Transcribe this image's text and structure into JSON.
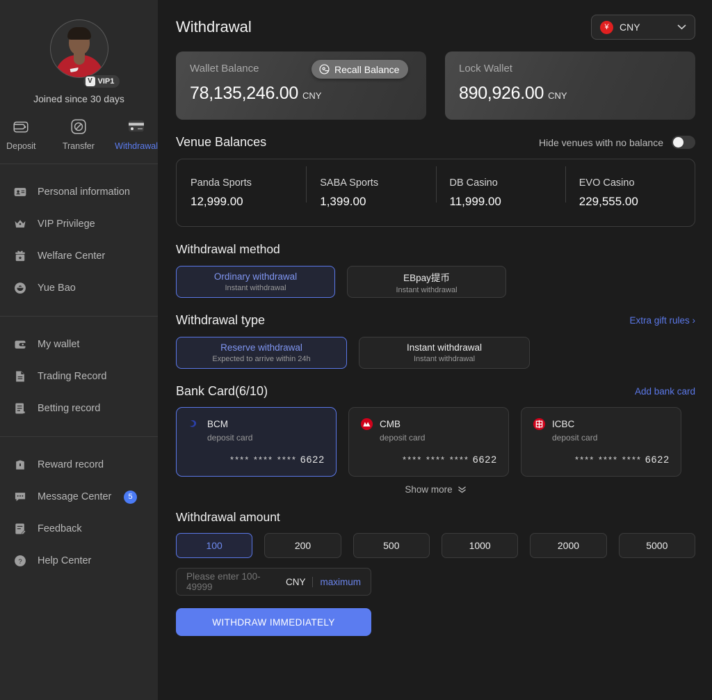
{
  "sidebar": {
    "profile": {
      "avatar_alt": "user-avatar",
      "vip_badge_mark": "V",
      "vip_label": "VIP1",
      "joined": "Joined since 30 days"
    },
    "quick_actions": [
      {
        "icon": "wallet-deposit-icon",
        "label": "Deposit",
        "active": false
      },
      {
        "icon": "transfer-icon",
        "label": "Transfer",
        "active": false
      },
      {
        "icon": "credit-card-withdrawal-icon",
        "label": "Withdrawal",
        "active": true
      }
    ],
    "groups": [
      {
        "items": [
          {
            "icon": "id-card-icon",
            "label": "Personal information"
          },
          {
            "icon": "crown-icon",
            "label": "VIP Privilege"
          },
          {
            "icon": "gift-icon",
            "label": "Welfare Center"
          },
          {
            "icon": "yuebao-icon",
            "label": "Yue Bao"
          }
        ]
      },
      {
        "items": [
          {
            "icon": "wallet-icon",
            "label": "My wallet"
          },
          {
            "icon": "document-icon",
            "label": "Trading Record"
          },
          {
            "icon": "bet-record-icon",
            "label": "Betting record"
          }
        ]
      },
      {
        "items": [
          {
            "icon": "reward-box-icon",
            "label": "Reward record"
          },
          {
            "icon": "message-icon",
            "label": "Message Center",
            "badge": "5"
          },
          {
            "icon": "feedback-icon",
            "label": "Feedback"
          },
          {
            "icon": "help-circle-icon",
            "label": "Help Center"
          }
        ]
      }
    ]
  },
  "header": {
    "title": "Withdrawal",
    "currency": {
      "symbol": "¥",
      "code": "CNY",
      "chevron": "⌄"
    }
  },
  "balances": {
    "wallet": {
      "label": "Wallet Balance",
      "amount": "78,135,246.00",
      "currency": "CNY",
      "recall_label": "Recall Balance"
    },
    "lock": {
      "label": "Lock Wallet",
      "amount": "890,926.00",
      "currency": "CNY"
    }
  },
  "venues": {
    "title": "Venue Balances",
    "hide_label": "Hide venues with no balance",
    "hide_enabled": false,
    "items": [
      {
        "name": "Panda Sports",
        "value": "12,999.00"
      },
      {
        "name": "SABA Sports",
        "value": "1,399.00"
      },
      {
        "name": "DB Casino",
        "value": "11,999.00"
      },
      {
        "name": "EVO Casino",
        "value": "229,555.00"
      }
    ]
  },
  "withdrawal_method": {
    "title": "Withdrawal method",
    "options": [
      {
        "main": "Ordinary withdrawal",
        "sub": "Instant withdrawal",
        "selected": true
      },
      {
        "main": "EBpay提币",
        "sub": "Instant withdrawal",
        "selected": false
      }
    ]
  },
  "withdrawal_type": {
    "title": "Withdrawal type",
    "extra_link": "Extra gift rules",
    "extra_chevron": "›",
    "options": [
      {
        "main": "Reserve withdrawal",
        "sub": "Expected to arrive within 24h",
        "selected": true
      },
      {
        "main": "Instant withdrawal",
        "sub": "Instant withdrawal",
        "selected": false
      }
    ]
  },
  "bank_cards": {
    "title": "Bank Card(6/10)",
    "add_link": "Add bank card",
    "show_more": "Show more",
    "show_more_chevron": "»",
    "masked": "****  ****  ****",
    "cards": [
      {
        "logo": "bcm-logo-icon",
        "name": "BCM",
        "type": "deposit card",
        "last4": "6622",
        "selected": true
      },
      {
        "logo": "cmb-logo-icon",
        "name": "CMB",
        "type": "deposit card",
        "last4": "6622",
        "selected": false
      },
      {
        "logo": "icbc-logo-icon",
        "name": "ICBC",
        "type": "deposit card",
        "last4": "6622",
        "selected": false
      }
    ]
  },
  "amount": {
    "title": "Withdrawal amount",
    "chips": [
      {
        "value": "100",
        "selected": true
      },
      {
        "value": "200",
        "selected": false
      },
      {
        "value": "500",
        "selected": false
      },
      {
        "value": "1000",
        "selected": false
      },
      {
        "value": "2000",
        "selected": false
      },
      {
        "value": "5000",
        "selected": false
      }
    ],
    "input": {
      "value": "",
      "placeholder": "Please enter 100-49999",
      "currency": "CNY",
      "max_label": "maximum"
    },
    "submit_label": "WITHDRAW IMMEDIATELY"
  },
  "colors": {
    "accent_blue": "#5b7cf0",
    "link_blue": "#5b78e8",
    "sidebar_bg": "#2a2a2a",
    "page_bg": "#1c1c1c",
    "card_bg": "#242424",
    "cny_red": "#e02020",
    "badge_blue": "#4b7bf5"
  }
}
